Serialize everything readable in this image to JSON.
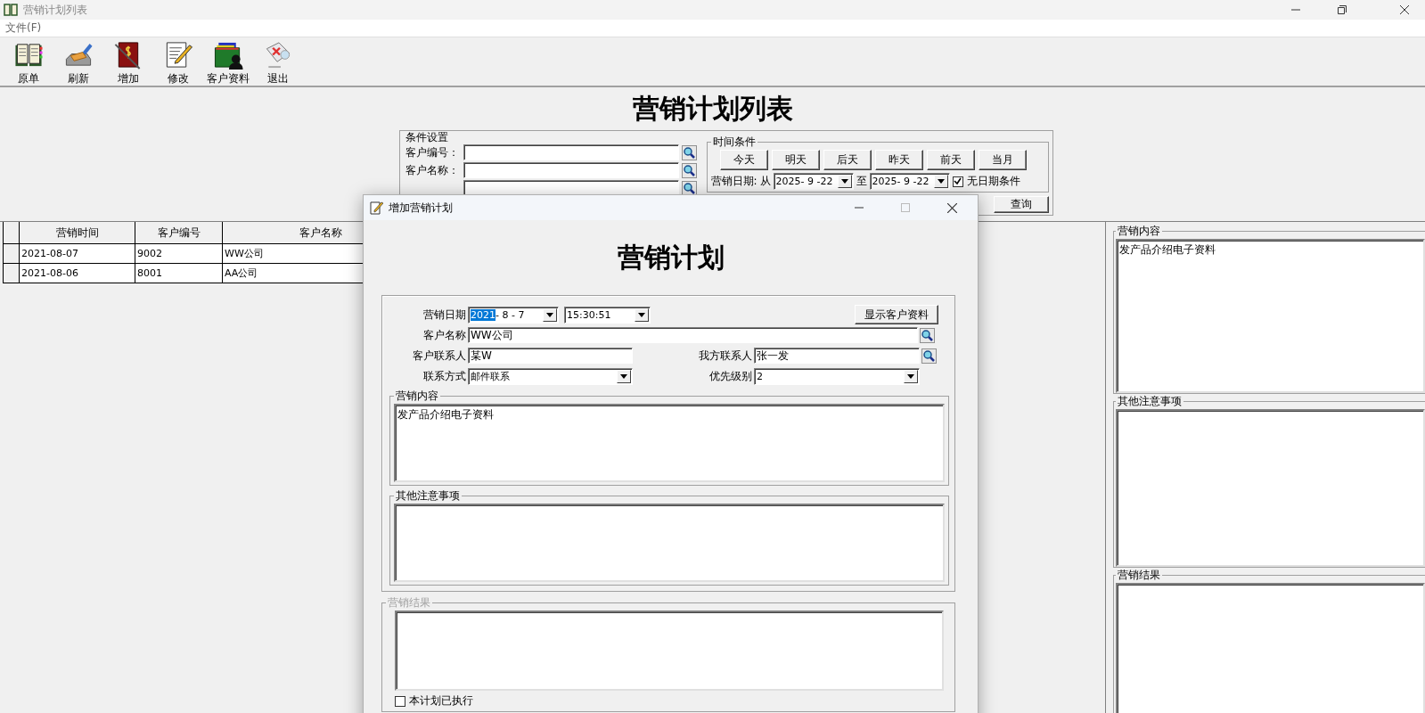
{
  "window": {
    "title": "营销计划列表",
    "menu": [
      "文件(F)"
    ]
  },
  "toolbar": [
    {
      "label": "原单"
    },
    {
      "label": "刷新"
    },
    {
      "label": "增加"
    },
    {
      "label": "修改"
    },
    {
      "label": "客户资料"
    },
    {
      "label": "退出"
    }
  ],
  "heading": "营销计划列表",
  "conditions": {
    "title": "条件设置",
    "fields": [
      {
        "label": "客户编号："
      },
      {
        "label": "客户名称："
      }
    ]
  },
  "time_conditions": {
    "title": "时间条件",
    "buttons": [
      "今天",
      "明天",
      "后天",
      "昨天",
      "前天",
      "当月"
    ],
    "date_label": "营销日期:",
    "from": "从",
    "start_date": "2025- 9 -22",
    "to": "至",
    "end_date": "2025- 9 -22",
    "no_date": {
      "label": "无日期条件",
      "checked": true
    }
  },
  "query_button": "查询",
  "table": {
    "columns": [
      "营销时间",
      "客户编号",
      "客户名称"
    ],
    "rows": [
      [
        "2021-08-07",
        "9002",
        "WW公司"
      ],
      [
        "2021-08-06",
        "8001",
        "AA公司"
      ]
    ]
  },
  "side_panels": [
    {
      "title": "营销内容",
      "text": "发产品介绍电子资料"
    },
    {
      "title": "其他注意事项"
    },
    {
      "title": "营销结果"
    }
  ],
  "dialog": {
    "title": "增加营销计划",
    "heading": "营销计划",
    "date": {
      "label": "营销日期",
      "year": "2021",
      "rest": "- 8 - 7",
      "year_highlighted": true,
      "time": "15:30:51"
    },
    "show_button": "显示客户资料",
    "customer": {
      "label": "客户名称",
      "value": "WW公司"
    },
    "contact": {
      "label": "客户联系人",
      "value": "某W"
    },
    "our_contact": {
      "label": "我方联系人",
      "value": "张一发"
    },
    "method": {
      "label": "联系方式",
      "value": "邮件联系"
    },
    "priority": {
      "label": "优先级别",
      "value": "2"
    },
    "groups": [
      {
        "title": "营销内容",
        "text": "发产品介绍电子资料",
        "disabled": false
      },
      {
        "title": "其他注意事项",
        "disabled": false
      },
      {
        "title": "营销结果",
        "disabled": true
      }
    ],
    "executed": {
      "label": "本计划已执行",
      "checked": false
    }
  }
}
